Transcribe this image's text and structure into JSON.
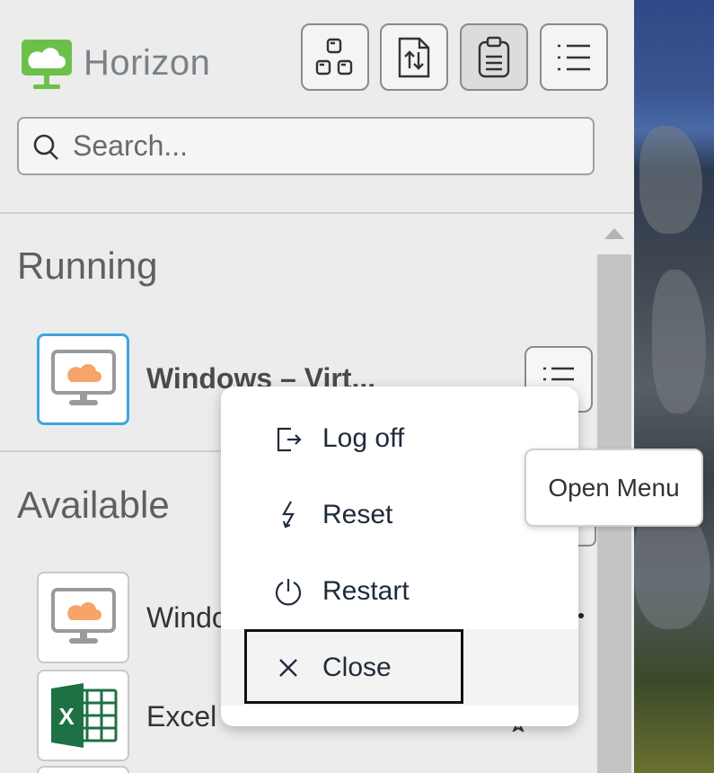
{
  "app": {
    "brand": "Horizon"
  },
  "toolbar": [
    {
      "name": "shortcuts-button",
      "icon": "apps-grid-icon",
      "active": false
    },
    {
      "name": "file-transfer-button",
      "icon": "file-transfer-icon",
      "active": false
    },
    {
      "name": "clipboard-button",
      "icon": "clipboard-icon",
      "active": true
    },
    {
      "name": "menu-button",
      "icon": "list-menu-icon",
      "active": false
    }
  ],
  "search": {
    "placeholder": "Search...",
    "value": ""
  },
  "sections": {
    "running": "Running",
    "available": "Available"
  },
  "running": [
    {
      "name": "Windows – Virt...",
      "icon": "desktop-cloud-icon",
      "selected": true
    }
  ],
  "available": [
    {
      "name": "Windo",
      "icon": "desktop-cloud-icon"
    },
    {
      "name": "Excel",
      "icon": "excel-icon"
    }
  ],
  "context_menu": {
    "items": [
      {
        "label": "Log off",
        "icon": "log-off-icon"
      },
      {
        "label": "Reset",
        "icon": "reset-icon"
      },
      {
        "label": "Restart",
        "icon": "power-icon"
      },
      {
        "label": "Close",
        "icon": "close-icon",
        "focused": true
      }
    ]
  },
  "tooltip": {
    "text": "Open Menu"
  },
  "colors": {
    "accent": "#3ea6e0",
    "logo_green": "#6cc04a",
    "cloud_orange": "#f6a46a",
    "excel_green": "#1e7145"
  }
}
